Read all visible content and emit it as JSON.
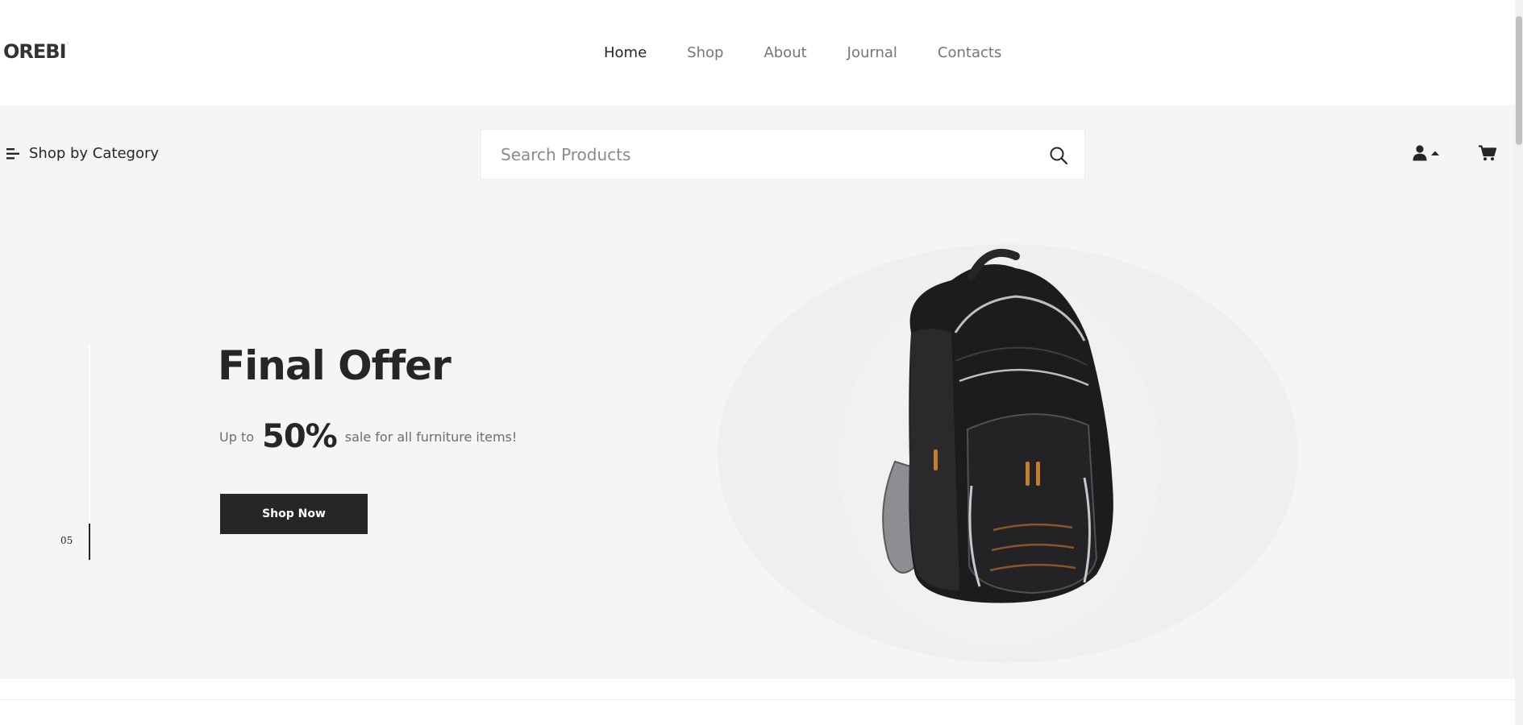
{
  "header": {
    "logo_text": "OREBI",
    "nav": [
      {
        "label": "Home",
        "active": true
      },
      {
        "label": "Shop",
        "active": false
      },
      {
        "label": "About",
        "active": false
      },
      {
        "label": "Journal",
        "active": false
      },
      {
        "label": "Contacts",
        "active": false
      }
    ]
  },
  "toolbar": {
    "category_label": "Shop by Category",
    "search_placeholder": "Search Products",
    "icons": {
      "search": "search-icon",
      "user": "user-icon",
      "caret": "caret-up-icon",
      "cart": "cart-icon",
      "category": "menu-lines-icon"
    }
  },
  "hero": {
    "title": "Final Offer",
    "sub_prefix": "Up to",
    "sub_big": "50%",
    "sub_suffix": "sale for all furniture items!",
    "button_label": "Shop Now",
    "slide_number": "05"
  },
  "colors": {
    "primary": "#262626",
    "toolbar_bg": "#f5f5f3",
    "hero_bg": "#f4f5f6",
    "nav_inactive": "#767676"
  }
}
